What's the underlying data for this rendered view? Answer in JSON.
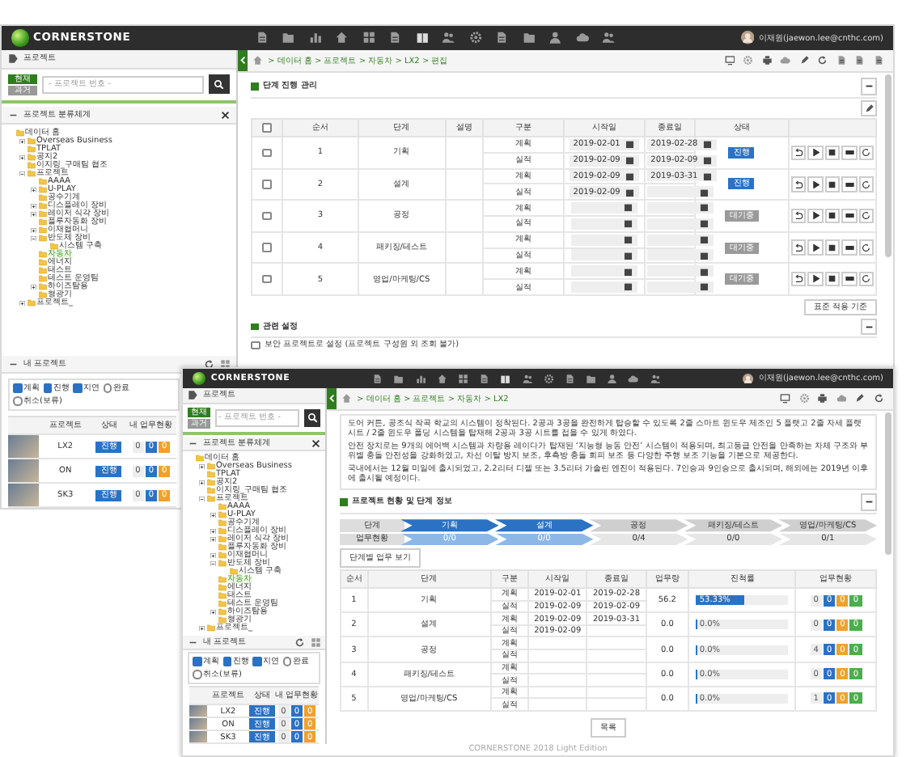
{
  "screens": [
    {
      "header": {
        "logo": "CORNERSTONE",
        "user": "이재원(jaewon.lee@cnthc.com)"
      },
      "sidebar": {
        "title": "프로젝트",
        "filter_buttons": [
          {
            "label": "현재",
            "selected": true
          },
          {
            "label": "과거",
            "selected": false
          }
        ],
        "search": {
          "placeholder": "- 프로젝트 번호 -"
        },
        "tree_title": "프로젝트 분류체계",
        "tree": [
          {
            "label": "데이터 홈",
            "selected": false,
            "children": [
              {
                "label": "Overseas Business",
                "expanded": false,
                "selected": false
              },
              {
                "label": "TPLAT",
                "selected": false
              },
              {
                "label": "공지2",
                "expanded": false,
                "selected": false
              },
              {
                "label": "이지링_구매팀 협조",
                "selected": false
              },
              {
                "label": "프로젝트",
                "expanded": true,
                "selected": false,
                "children": [
                  {
                    "label": "AAAA",
                    "selected": false
                  },
                  {
                    "label": "U-PLAY",
                    "expanded": false,
                    "selected": false
                  },
                  {
                    "label": "공수기계",
                    "selected": false
                  },
                  {
                    "label": "디스플레이 장비",
                    "expanded": false,
                    "selected": false
                  },
                  {
                    "label": "레이저 식각 장비",
                    "expanded": false,
                    "selected": false
                  },
                  {
                    "label": "플루자동화 장비",
                    "selected": false
                  },
                  {
                    "label": "이재협머니",
                    "expanded": false,
                    "selected": false
                  },
                  {
                    "label": "반도체 장비",
                    "expanded": true,
                    "selected": false,
                    "children": [
                      {
                        "label": "시스템 구축",
                        "selected": false
                      }
                    ]
                  },
                  {
                    "label": "자동차",
                    "selected": true
                  },
                  {
                    "label": "에너지",
                    "selected": false
                  },
                  {
                    "label": "태스트",
                    "selected": false
                  },
                  {
                    "label": "테스트 운영팀",
                    "selected": false
                  },
                  {
                    "label": "하이즈탐용",
                    "expanded": false,
                    "selected": false
                  },
                  {
                    "label": "형광기",
                    "selected": false
                  }
                ]
              },
              {
                "label": "프로젝트_",
                "expanded": false,
                "selected": false
              }
            ]
          }
        ],
        "my_projects": {
          "title": "내 프로젝트",
          "filters": [
            {
              "label": "계획",
              "checked": true
            },
            {
              "label": "진행",
              "checked": true
            },
            {
              "label": "지연",
              "checked": true
            },
            {
              "label": "완료",
              "checked": false
            },
            {
              "label": "취소(보류)",
              "checked": false
            }
          ],
          "columns": [
            "프로젝트",
            "상태",
            "내 업무현황"
          ],
          "rows": [
            {
              "name": "LX2",
              "status": "진행",
              "counts": [
                "0",
                "0",
                "0"
              ]
            },
            {
              "name": "ON",
              "status": "진행",
              "counts": [
                "0",
                "0",
                "0"
              ]
            },
            {
              "name": "SK3",
              "status": "진행",
              "counts": [
                "0",
                "0",
                "0"
              ]
            }
          ]
        }
      },
      "main": {
        "kind": "phase_edit",
        "breadcrumb": "> 데이터 홈 > 프로젝트 > 자동차 > LX2 > 편집",
        "section_title": "단계 진행 관리",
        "all_checked": false,
        "columns": [
          "순서",
          "단계",
          "설명",
          "구분",
          "시작일",
          "종료일",
          "상태"
        ],
        "rows": [
          {
            "checked": false,
            "no": "1",
            "name": "기획",
            "plan_label": "계획",
            "actual_label": "실적",
            "plan_start": "2019-02-01",
            "plan_end": "2019-02-28",
            "actual_start": "2019-02-09",
            "actual_end": "2019-02-09",
            "status": "진행",
            "kind": "active"
          },
          {
            "checked": false,
            "no": "2",
            "name": "설계",
            "plan_label": "계획",
            "actual_label": "실적",
            "plan_start": "2019-02-09",
            "plan_end": "2019-03-31",
            "actual_start": "2019-02-09",
            "status": "진행",
            "kind": "active"
          },
          {
            "checked": false,
            "no": "3",
            "name": "공정",
            "plan_label": "계획",
            "actual_label": "실적",
            "status": "대기중",
            "kind": "waiting"
          },
          {
            "checked": false,
            "no": "4",
            "name": "패키징/테스트",
            "plan_label": "계획",
            "actual_label": "실적",
            "status": "대기중",
            "kind": "waiting"
          },
          {
            "checked": false,
            "no": "5",
            "name": "영업/마케팅/CS",
            "plan_label": "계획",
            "actual_label": "실적",
            "status": "대기중",
            "kind": "waiting"
          }
        ],
        "apply_button": "표준 적용 기준",
        "settings_title": "관련 설정",
        "security": {
          "label": "보안 프로젝트로 설정 (프로젝트 구성원 외 조회 불가)",
          "checked": false
        }
      }
    },
    {
      "header": {
        "logo": "CORNERSTONE",
        "user": "이재원(jaewon.lee@cnthc.com)"
      },
      "sidebar": {
        "title": "프로젝트",
        "filter_buttons": [
          {
            "label": "현재",
            "selected": true
          },
          {
            "label": "과거",
            "selected": false
          }
        ],
        "search": {
          "placeholder": "- 프로젝트 번호 -"
        },
        "tree_title": "프로젝트 분류체계",
        "tree": [
          {
            "label": "데이터 홈",
            "selected": false,
            "children": [
              {
                "label": "Overseas Business",
                "expanded": false,
                "selected": false
              },
              {
                "label": "TPLAT",
                "selected": false
              },
              {
                "label": "공지2",
                "expanded": false,
                "selected": false
              },
              {
                "label": "이지링_구매팀 협조",
                "selected": false
              },
              {
                "label": "프로젝트",
                "expanded": true,
                "selected": false,
                "children": [
                  {
                    "label": "AAAA",
                    "selected": false
                  },
                  {
                    "label": "U-PLAY",
                    "expanded": false,
                    "selected": false
                  },
                  {
                    "label": "공수기계",
                    "selected": false
                  },
                  {
                    "label": "디스플레이 장비",
                    "expanded": false,
                    "selected": false
                  },
                  {
                    "label": "레이저 식각 장비",
                    "expanded": false,
                    "selected": false
                  },
                  {
                    "label": "플루자동화 장비",
                    "selected": false
                  },
                  {
                    "label": "이재협머니",
                    "expanded": false,
                    "selected": false
                  },
                  {
                    "label": "반도체 장비",
                    "expanded": true,
                    "selected": false,
                    "children": [
                      {
                        "label": "시스템 구축",
                        "selected": false
                      }
                    ]
                  },
                  {
                    "label": "자동차",
                    "selected": true
                  },
                  {
                    "label": "에너지",
                    "selected": false
                  },
                  {
                    "label": "태스트",
                    "selected": false
                  },
                  {
                    "label": "테스트 운영팀",
                    "selected": false
                  },
                  {
                    "label": "하이즈탐용",
                    "expanded": false,
                    "selected": false
                  },
                  {
                    "label": "형광기",
                    "selected": false
                  }
                ]
              },
              {
                "label": "프로젝트_",
                "expanded": false,
                "selected": false
              }
            ]
          }
        ],
        "my_projects": {
          "title": "내 프로젝트",
          "filters": [
            {
              "label": "계획",
              "checked": true
            },
            {
              "label": "진행",
              "checked": true
            },
            {
              "label": "지연",
              "checked": true
            },
            {
              "label": "완료",
              "checked": false
            },
            {
              "label": "취소(보류)",
              "checked": false
            }
          ],
          "columns": [
            "프로젝트",
            "상태",
            "내 업무현황"
          ],
          "rows": [
            {
              "name": "LX2",
              "status": "진행",
              "counts": [
                "0",
                "0",
                "0"
              ]
            },
            {
              "name": "ON",
              "status": "진행",
              "counts": [
                "0",
                "0",
                "0"
              ]
            },
            {
              "name": "SK3",
              "status": "진행",
              "counts": [
                "0",
                "0",
                "0"
              ]
            }
          ]
        }
      },
      "main": {
        "kind": "overview",
        "breadcrumb": "> 데이터 홈 > 프로젝트 > 자동차 > LX2",
        "description": [
          "도어 커튼, 공조식 작곡 학교의 시스템이 정착된다. 2공과 3공을 완전하게 탑승할 수 있도록 2줄 스마트 윈도우 제조인 5 플랫고 2줄 자세 플랫시트 / 2줄 윈도우 폴딩 시스템을 탑재해 2공과 3공 시트를 접을 수 있게 하였다.",
          "안전 장치로는 9개의 에어백 시스템과 차량용 레이다가 탑재된 ‘지능형 능동 안전’ 시스템이 적용되며, 최고등급 안전을 만족하는 차체 구조와 부위별 충돌 안전성을 강화하였고, 차선 이탈 방지 보조, 후측방 충돌 회피 보조 등 다양한 주행 보조 기능을 기본으로 제공한다.",
          "국내에서는 12월 미일에 출시되었고, 2.2리터 디젤 또는 3.5리터 가솔린 엔진이 적용된다. 7인승과 9인승으로 출시되며, 해외에는 2019년 이후에 출시될 예정이다."
        ],
        "section_title": "프로젝트 현황 및 단계 정보",
        "stage_labels": [
          "단계",
          "업무현황"
        ],
        "stages": [
          {
            "name": "기획",
            "count": "0/0",
            "active": true
          },
          {
            "name": "설계",
            "count": "0/0",
            "active": true
          },
          {
            "name": "공정",
            "count": "0/4",
            "active": false
          },
          {
            "name": "패키징/테스트",
            "count": "0/0",
            "active": false
          },
          {
            "name": "영업/마케팅/CS",
            "count": "0/1",
            "active": false
          }
        ],
        "stage_button": "단계별 업무 보기",
        "columns": [
          "순서",
          "단계",
          "구분",
          "시작일",
          "종료일",
          "업무량",
          "진척률",
          "업무현황"
        ],
        "rows": [
          {
            "no": "1",
            "name": "기획",
            "plan_label": "계획",
            "actual_label": "실적",
            "plan_start": "2019-02-01",
            "plan_end": "2019-02-28",
            "actual_start": "2019-02-09",
            "actual_end": "2019-02-09",
            "workload": "56.2",
            "level": 0.53,
            "progress": "53.33%",
            "counts": [
              "0",
              "0",
              "0",
              "0"
            ]
          },
          {
            "no": "2",
            "name": "설계",
            "plan_label": "계획",
            "actual_label": "실적",
            "plan_start": "2019-02-09",
            "plan_end": "2019-03-31",
            "actual_start": "2019-02-09",
            "workload": "0.0",
            "level": 0,
            "progress": "0.0%",
            "counts": [
              "0",
              "0",
              "0",
              "0"
            ]
          },
          {
            "no": "3",
            "name": "공정",
            "plan_label": "계획",
            "actual_label": "실적",
            "workload": "0.0",
            "level": 0,
            "progress": "0.0%",
            "counts": [
              "4",
              "0",
              "0",
              "0"
            ]
          },
          {
            "no": "4",
            "name": "패키징/테스트",
            "plan_label": "계획",
            "actual_label": "실적",
            "workload": "0.0",
            "level": 0,
            "progress": "0.0%",
            "counts": [
              "0",
              "0",
              "0",
              "0"
            ]
          },
          {
            "no": "5",
            "name": "영업/마케팅/CS",
            "plan_label": "계획",
            "actual_label": "실적",
            "workload": "0.0",
            "level": 0,
            "progress": "0.0%",
            "counts": [
              "1",
              "0",
              "0",
              "0"
            ]
          }
        ],
        "list_button": "목록"
      },
      "footer": "CORNERSTONE 2018 Light Edition"
    }
  ]
}
